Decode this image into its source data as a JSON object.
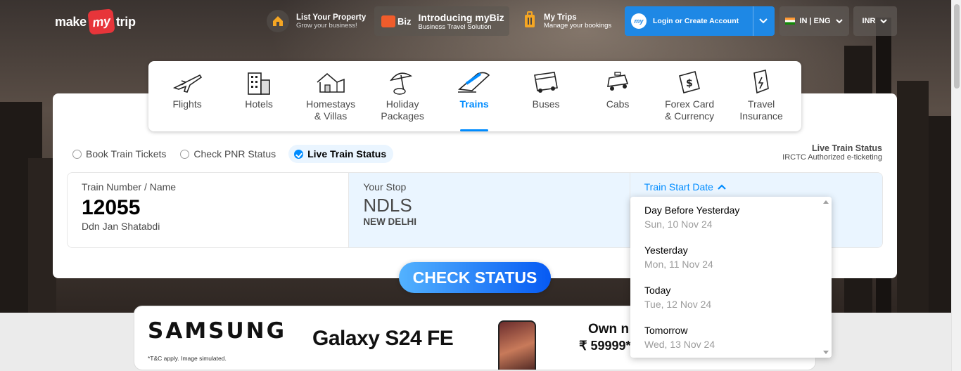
{
  "header": {
    "logo": {
      "pre": "make",
      "mid": "my",
      "post": "trip"
    },
    "list_property": {
      "title": "List Your Property",
      "subtitle": "Grow your business!"
    },
    "mybiz": {
      "badge": "Biz",
      "title": "Introducing myBiz",
      "subtitle": "Business Travel Solution"
    },
    "my_trips": {
      "title": "My Trips",
      "subtitle": "Manage your bookings"
    },
    "login": {
      "avatar": "my",
      "label": "Login or Create Account"
    },
    "language": "IN | ENG",
    "currency": "INR"
  },
  "nav": {
    "items": [
      {
        "label": "Flights",
        "icon": "airplane-icon"
      },
      {
        "label": "Hotels",
        "icon": "hotel-building-icon"
      },
      {
        "label": "Homestays\n& Villas",
        "icon": "house-icon"
      },
      {
        "label": "Holiday\nPackages",
        "icon": "beach-umbrella-icon"
      },
      {
        "label": "Trains",
        "icon": "train-icon",
        "active": true
      },
      {
        "label": "Buses",
        "icon": "bus-icon"
      },
      {
        "label": "Cabs",
        "icon": "cab-icon"
      },
      {
        "label": "Forex Card\n& Currency",
        "icon": "forex-card-icon"
      },
      {
        "label": "Travel\nInsurance",
        "icon": "insurance-shield-icon"
      }
    ]
  },
  "trip_type": {
    "options": [
      "Book Train Tickets",
      "Check PNR Status",
      "Live Train Status"
    ],
    "selected": "Live Train Status"
  },
  "irctc": {
    "title": "Live Train Status",
    "subtitle": "IRCTC Authorized e-ticketing"
  },
  "form": {
    "train": {
      "label": "Train Number / Name",
      "value": "12055",
      "name": "Ddn Jan Shatabdi"
    },
    "stop": {
      "label": "Your Stop",
      "value": "NDLS",
      "name": "NEW DELHI"
    },
    "date": {
      "label": "Train Start Date"
    }
  },
  "date_options": [
    {
      "title": "Day Before Yesterday",
      "date": "Sun, 10 Nov 24"
    },
    {
      "title": "Yesterday",
      "date": "Mon, 11 Nov 24"
    },
    {
      "title": "Today",
      "date": "Tue, 12 Nov 24"
    },
    {
      "title": "Tomorrow",
      "date": "Wed, 13 Nov 24"
    }
  ],
  "check_button": "CHECK STATUS",
  "ad": {
    "brand": "SAMSUNG",
    "model": "Galaxy S24 FE",
    "disclaimer": "*T&C apply. Image simulated.",
    "own": "Own n",
    "price": "₹ 59999*"
  },
  "colors": {
    "accent": "#008cff",
    "logo_red": "#e7353a",
    "login_blue": "#1e88e5"
  }
}
